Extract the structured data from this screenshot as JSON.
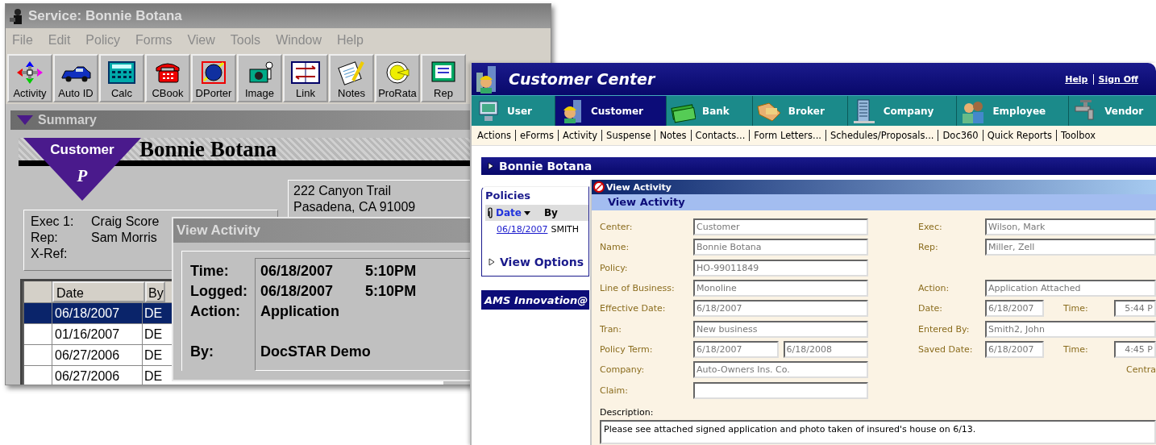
{
  "service_window": {
    "title": "Service: Bonnie Botana",
    "menu": [
      "File",
      "Edit",
      "Policy",
      "Forms",
      "View",
      "Tools",
      "Window",
      "Help"
    ],
    "toolbar": [
      "Activity",
      "Auto ID",
      "Calc",
      "CBook",
      "DPorter",
      "Image",
      "Link",
      "Notes",
      "ProRata",
      "Rep"
    ],
    "summary_title": "Summary",
    "banner": {
      "badge": "Customer",
      "badge_letter": "P",
      "name": "Bonnie Botana"
    },
    "address": [
      "222 Canyon Trail",
      "Pasadena, CA 91009"
    ],
    "info": [
      {
        "label": "Exec 1:",
        "value": "Craig Score"
      },
      {
        "label": "Rep:",
        "value": "Sam Morris"
      },
      {
        "label": "X-Ref:"
      }
    ],
    "table": {
      "columns": [
        "Date",
        "By"
      ],
      "rows": [
        {
          "date": "06/18/2007",
          "by": "DE",
          "selected": true
        },
        {
          "date": "01/16/2007",
          "by": "DE",
          "selected": false
        },
        {
          "date": "06/27/2006",
          "by": "DE",
          "selected": false
        },
        {
          "date": "06/27/2006",
          "by": "DE",
          "selected": false
        }
      ]
    },
    "dialog": {
      "title": "View Activity",
      "fields": [
        {
          "label": "Time:",
          "values": [
            "06/18/2007",
            "5:10PM"
          ]
        },
        {
          "label": "Logged:",
          "values": [
            "06/18/2007",
            "5:10PM"
          ]
        },
        {
          "label": "Action:",
          "values": [
            "Application"
          ]
        },
        {
          "label": "By:",
          "values": [
            "DocSTAR Demo"
          ]
        }
      ]
    }
  },
  "customer_center": {
    "title": "Customer Center",
    "links": [
      "Help",
      "Sign Off"
    ],
    "tabs": [
      {
        "label": "User",
        "selected": false
      },
      {
        "label": "Customer",
        "selected": true
      },
      {
        "label": "Bank",
        "selected": false
      },
      {
        "label": "Broker",
        "selected": false
      },
      {
        "label": "Company",
        "selected": false
      },
      {
        "label": "Employee",
        "selected": false
      },
      {
        "label": "Vendor",
        "selected": false
      }
    ],
    "actions": [
      "Actions",
      "eForms",
      "Activity",
      "Suspense",
      "Notes",
      "Contacts...",
      "Form Letters...",
      "Schedules/Proposals...",
      "Doc360",
      "Quick Reports",
      "Toolbox"
    ],
    "client_bar": "Bonnie Botana",
    "policies": {
      "title": "Policies",
      "columns": [
        "Date",
        "By"
      ],
      "rows": [
        {
          "date": "06/18/2007",
          "by": "SMITH"
        }
      ]
    },
    "view_options": "View Options",
    "footer_bar": "AMS Innovation@",
    "dialog": {
      "title": "View Activity",
      "heading": "View Activity",
      "rows": [
        {
          "left": {
            "label": "Center:",
            "inputs": [
              {
                "value": "Customer"
              }
            ]
          },
          "right": {
            "kind": "field",
            "label": "Exec:",
            "inputs": [
              {
                "value": "Wilson, Mark"
              }
            ]
          }
        },
        {
          "left": {
            "label": "Name:",
            "inputs": [
              {
                "value": "Bonnie Botana"
              }
            ]
          },
          "right": {
            "kind": "field",
            "label": "Rep:",
            "inputs": [
              {
                "value": "Miller, Zell"
              }
            ]
          }
        },
        {
          "left": {
            "label": "Policy:",
            "inputs": [
              {
                "value": "HO-99011849"
              }
            ]
          }
        },
        {
          "left": {
            "label": "Line of Business:",
            "inputs": [
              {
                "value": "Monoline"
              }
            ]
          },
          "right": {
            "kind": "field",
            "label": "Action:",
            "inputs": [
              {
                "value": "Application Attached"
              }
            ]
          }
        },
        {
          "left": {
            "label": "Effective Date:",
            "inputs": [
              {
                "value": "6/18/2007"
              }
            ]
          },
          "right": {
            "kind": "datetime",
            "label": "Date:",
            "inputs": [
              {
                "value": "6/18/2007"
              }
            ],
            "time_label": "Time:",
            "time": "5:44 P"
          }
        },
        {
          "left": {
            "label": "Tran:",
            "inputs": [
              {
                "value": "New business"
              }
            ]
          },
          "right": {
            "kind": "field",
            "label": "Entered By:",
            "inputs": [
              {
                "value": "Smith2, John"
              }
            ]
          }
        },
        {
          "left": {
            "label": "Policy Term:",
            "inputs": [
              {
                "value": "6/18/2007"
              },
              {
                "value": "6/18/2008"
              }
            ]
          },
          "right": {
            "kind": "datetime",
            "label": "Saved Date:",
            "inputs": [
              {
                "value": "6/18/2007"
              }
            ],
            "time_label": "Time:",
            "time": "4:45 P"
          }
        },
        {
          "left": {
            "label": "Company:",
            "inputs": [
              {
                "value": "Auto-Owners Ins. Co."
              }
            ]
          },
          "right": {
            "kind": "note",
            "text": "Centra"
          }
        },
        {
          "left": {
            "label": "Claim:",
            "blank_field": true
          }
        }
      ],
      "description_label": "Description:",
      "description": "Please see attached signed application and photo taken of insured's house on 6/13."
    }
  }
}
